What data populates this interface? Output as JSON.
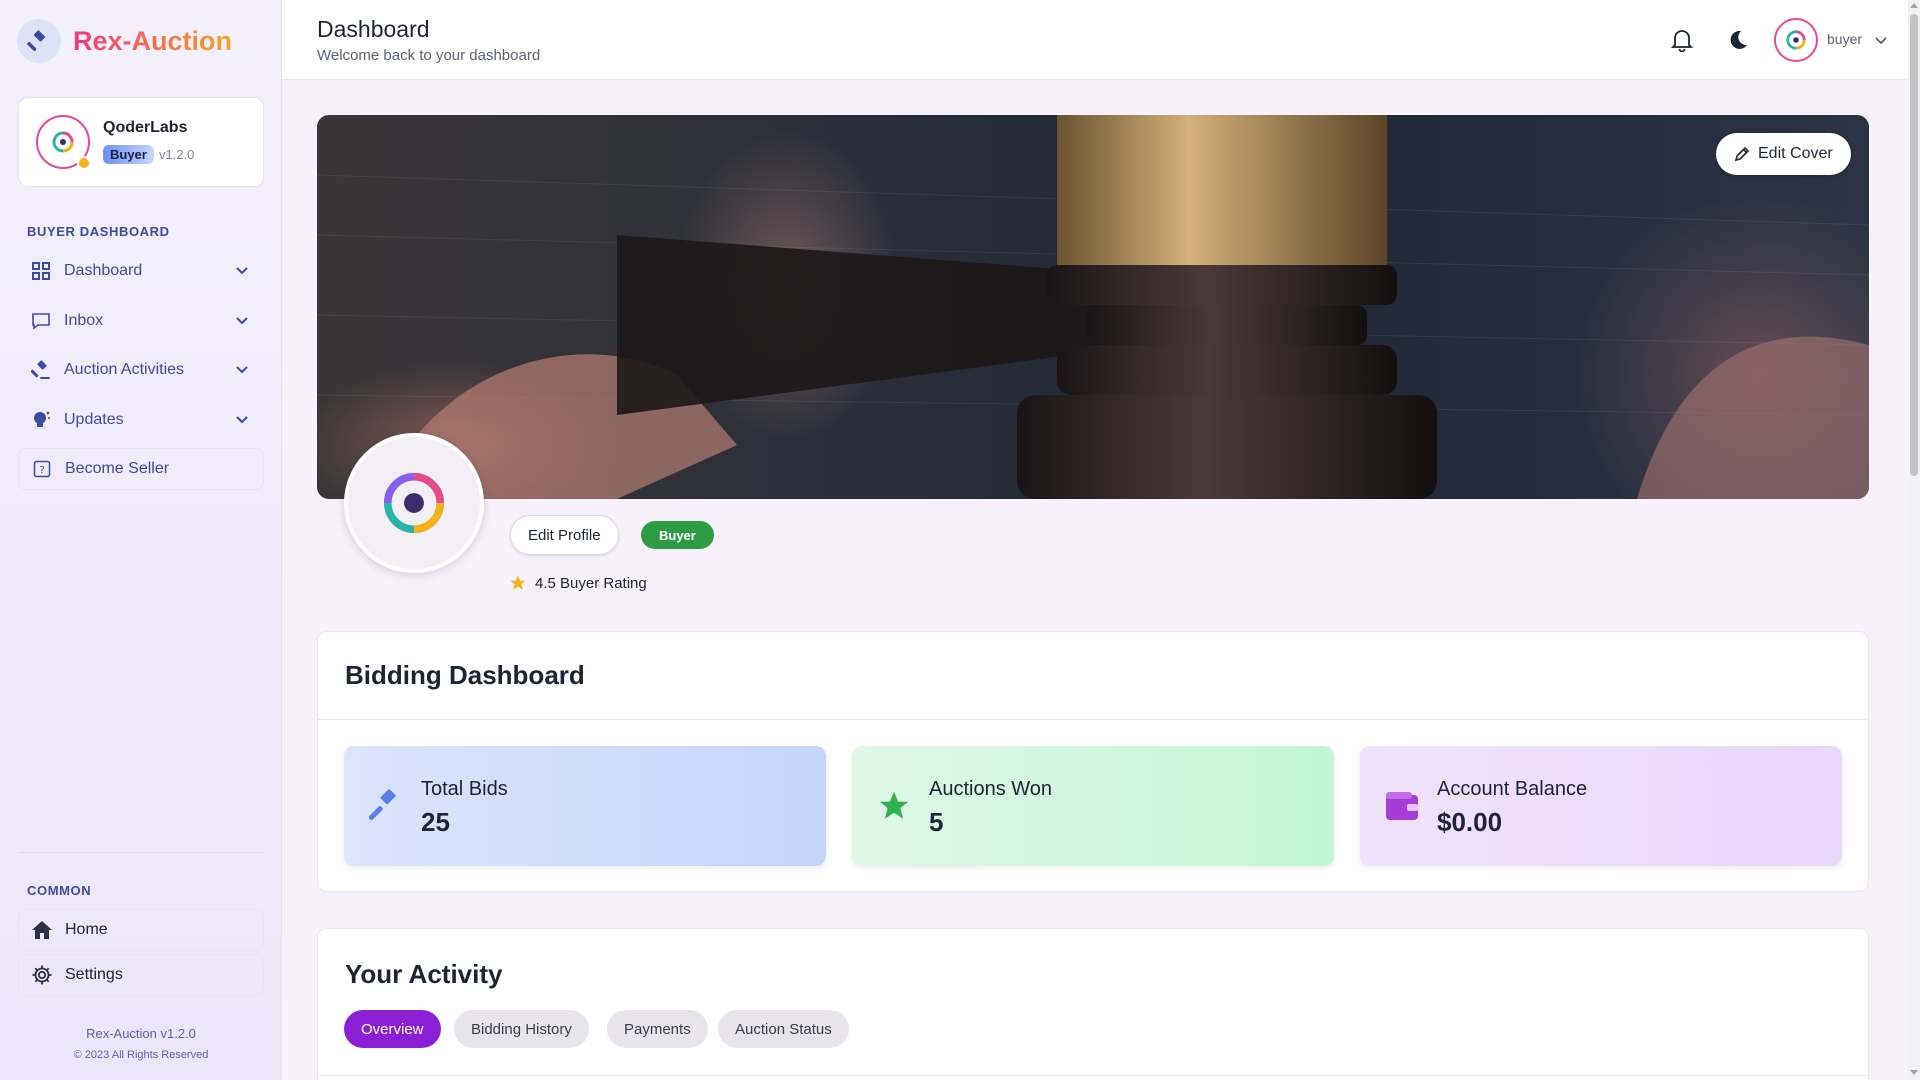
{
  "app": {
    "name": "Rex-Auction"
  },
  "profile": {
    "name": "QoderLabs",
    "role": "Buyer",
    "version": "v1.2.0"
  },
  "sidebar": {
    "section_label": "BUYER DASHBOARD",
    "items": [
      {
        "label": "Dashboard",
        "icon": "grid-icon"
      },
      {
        "label": "Inbox",
        "icon": "message-icon"
      },
      {
        "label": "Auction Activities",
        "icon": "gavel-icon"
      },
      {
        "label": "Updates",
        "icon": "lightbulb-icon"
      },
      {
        "label": "Become Seller",
        "icon": "help-box-icon"
      }
    ],
    "common_label": "COMMON",
    "common_items": [
      {
        "label": "Home",
        "icon": "home-icon"
      },
      {
        "label": "Settings",
        "icon": "gear-icon"
      }
    ],
    "footer_version": "Rex-Auction v1.2.0",
    "footer_copyright": "© 2023 All Rights Reserved"
  },
  "header": {
    "title": "Dashboard",
    "subtitle": "Welcome back to your dashboard",
    "username": "buyer"
  },
  "cover": {
    "edit_label": "Edit Cover"
  },
  "profile_row": {
    "edit_label": "Edit Profile",
    "badge": "Buyer",
    "rating_text": "4.5 Buyer Rating"
  },
  "bidding": {
    "title": "Bidding Dashboard",
    "stats": [
      {
        "label": "Total Bids",
        "value": "25",
        "icon": "gavel-icon"
      },
      {
        "label": "Auctions Won",
        "value": "5",
        "icon": "star-icon"
      },
      {
        "label": "Account Balance",
        "value": "$0.00",
        "icon": "wallet-icon"
      }
    ]
  },
  "activity": {
    "title": "Your Activity",
    "tabs": [
      "Overview",
      "Bidding History",
      "Payments",
      "Auction Status"
    ],
    "active_tab": "Overview"
  },
  "colors": {
    "accent_purple": "#8a1fd6",
    "sidebar_text": "#3f4aa1",
    "buyer_green": "#2e9c42",
    "brand_pink": "#ec3c7a",
    "brand_orange": "#f3a52a"
  }
}
